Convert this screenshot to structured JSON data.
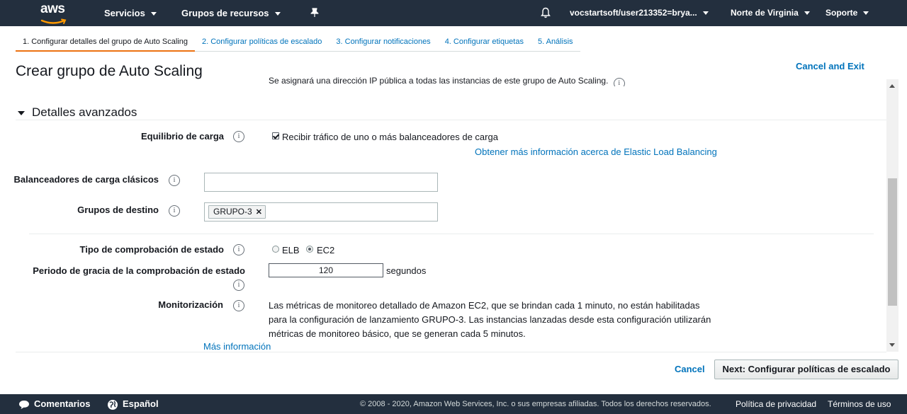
{
  "nav": {
    "logo": "aws",
    "services": "Servicios",
    "resource_groups": "Grupos de recursos",
    "account": "vocstartsoft/user213352=brya...",
    "region": "Norte de Virginia",
    "support": "Soporte",
    "pin_icon": "pin-icon",
    "bell_icon": "bell-icon"
  },
  "tabs": [
    {
      "label": "1. Configurar detalles del grupo de Auto Scaling"
    },
    {
      "label": "2. Configurar políticas de escalado"
    },
    {
      "label": "3. Configurar notificaciones"
    },
    {
      "label": "4. Configurar etiquetas"
    },
    {
      "label": "5. Análisis"
    }
  ],
  "page": {
    "title": "Crear grupo de Auto Scaling",
    "cancel_exit": "Cancel and Exit",
    "ghost_text": "Se asignará una dirección IP pública a todas las instancias de este grupo de Auto Scaling."
  },
  "advanced": {
    "heading": "Detalles avanzados",
    "load_balancing_label": "Equilibrio de carga",
    "receive_traffic": "Recibir tráfico de uno o más balanceadores de carga",
    "elb_link": "Obtener más información acerca de Elastic Load Balancing",
    "classic_lb_label": "Balanceadores de carga clásicos",
    "classic_lb_value": "",
    "target_groups_label": "Grupos de destino",
    "target_group_token": "GRUPO-3",
    "health_check_label": "Tipo de comprobación de estado",
    "health_elb": "ELB",
    "health_ec2": "EC2",
    "grace_label": "Periodo de gracia de la comprobación de estado",
    "grace_value": "120",
    "grace_unit": "segundos",
    "monitoring_label": "Monitorización",
    "monitoring_text": "Las métricas de monitoreo detallado de Amazon EC2, que se brindan cada 1 minuto, no están habilitadas para la configuración de lanzamiento GRUPO-3. Las instancias lanzadas desde esta configuración utilizarán métricas de monitoreo básico, que se generan cada 5 minutos.",
    "more_info": "Más información",
    "info_glyph": "i"
  },
  "actions": {
    "cancel": "Cancel",
    "next": "Next: Configurar políticas de escalado"
  },
  "footer": {
    "feedback": "Comentarios",
    "language": "Español",
    "copyright": "© 2008 - 2020, Amazon Web Services, Inc. o sus empresas afiliadas. Todos los derechos reservados.",
    "privacy": "Política de privacidad",
    "terms": "Términos de uso"
  }
}
